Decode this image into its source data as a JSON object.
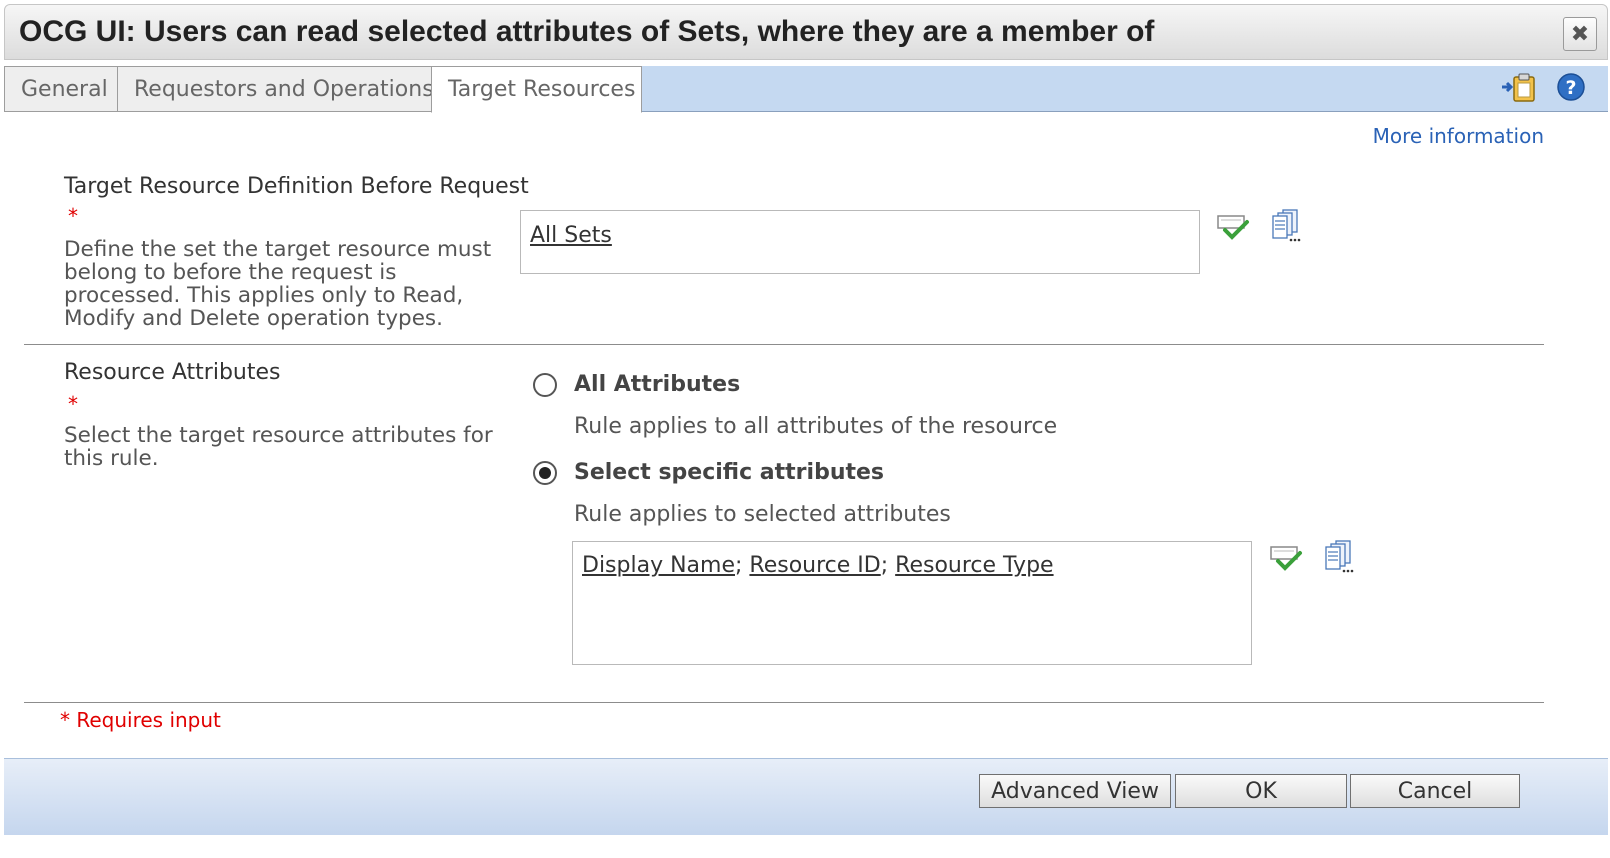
{
  "dialog": {
    "title": "OCG UI: Users can read selected attributes of Sets, where they are a member of",
    "close_icon": "close-icon"
  },
  "tabs": [
    {
      "label": "General",
      "active": false
    },
    {
      "label": "Requestors and Operations",
      "active": false
    },
    {
      "label": "Target Resources",
      "active": true
    }
  ],
  "toolbar": {
    "icons": [
      "paste-icon",
      "help-icon"
    ]
  },
  "more_info": "More information",
  "target_definition": {
    "title": "Target Resource Definition Before Request",
    "required_marker": "*",
    "description": "Define the set the target resource must belong to before the request is processed. This applies only to Read, Modify and Delete operation types.",
    "value": "All Sets",
    "icons": [
      "validate-check-icon",
      "browse-list-icon"
    ]
  },
  "resource_attributes": {
    "title": "Resource Attributes",
    "required_marker": "*",
    "description": "Select the target resource attributes for this rule.",
    "options": [
      {
        "label": "All Attributes",
        "description": "Rule applies to all attributes of the resource",
        "selected": false
      },
      {
        "label": "Select specific attributes",
        "description": "Rule applies to selected attributes",
        "selected": true
      }
    ],
    "selected_values": [
      "Display Name",
      "Resource ID",
      "Resource Type"
    ],
    "separator": ";",
    "icons": [
      "validate-check-icon",
      "browse-list-icon"
    ]
  },
  "requires_input": "* Requires input",
  "buttons": {
    "advanced": "Advanced View",
    "ok": "OK",
    "cancel": "Cancel"
  },
  "colors": {
    "tab_strip": "#c5d9f1",
    "link": "#2a62b6",
    "required": "#e00000",
    "check": "#3aa03a"
  }
}
